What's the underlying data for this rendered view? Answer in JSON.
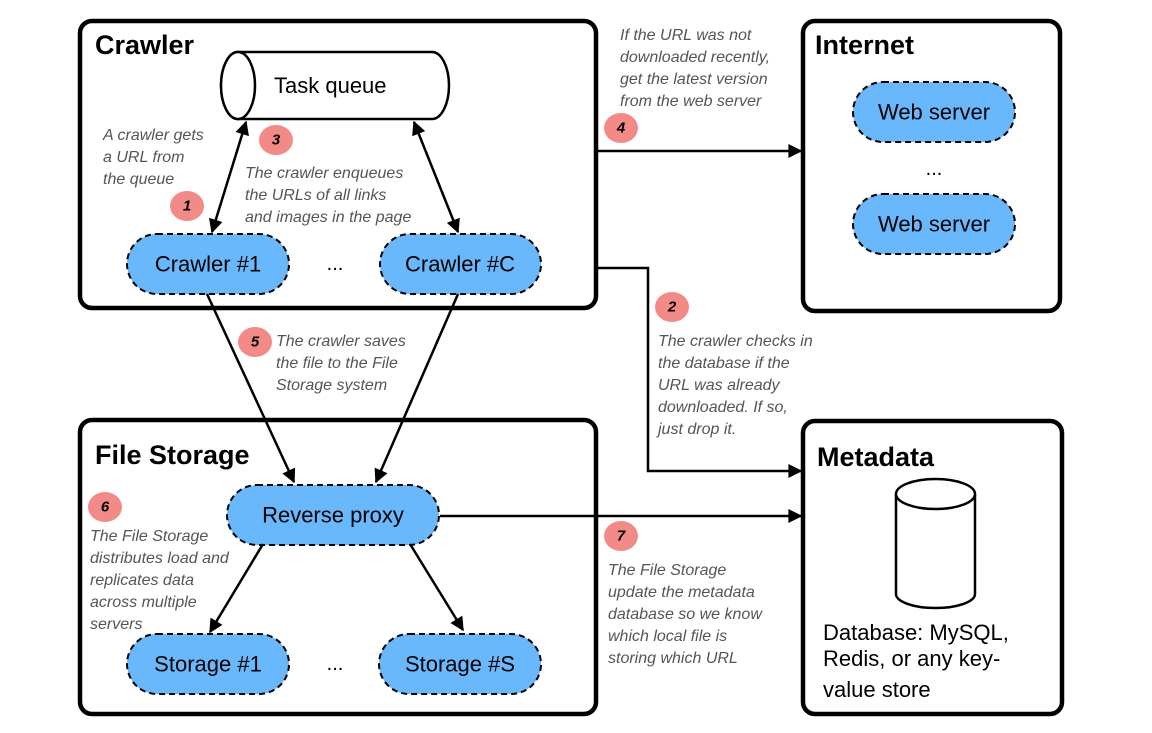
{
  "groups": {
    "crawler": {
      "title": "Crawler"
    },
    "internet": {
      "title": "Internet"
    },
    "file_storage": {
      "title": "File Storage"
    },
    "metadata": {
      "title": "Metadata"
    }
  },
  "nodes": {
    "task_queue": "Task queue",
    "crawler_1": "Crawler #1",
    "crawler_c": "Crawler #C",
    "crawler_ellipsis": "...",
    "web_server_1": "Web server",
    "web_server_2": "Web server",
    "web_ellipsis": "...",
    "reverse_proxy": "Reverse proxy",
    "storage_1": "Storage #1",
    "storage_s": "Storage #S",
    "storage_ellipsis": "...",
    "database_lines": [
      "Database: MySQL,",
      "Redis, or any key-",
      "value store"
    ]
  },
  "steps": [
    {
      "number": "1",
      "lines": [
        "A crawler gets",
        "a URL from",
        "the queue"
      ]
    },
    {
      "number": "2",
      "lines": [
        "The crawler checks in",
        "the database if the",
        "URL was already",
        "downloaded. If so,",
        "just drop it."
      ]
    },
    {
      "number": "3",
      "lines": [
        "The crawler enqueues",
        "the URLs of all links",
        "and images in the page"
      ]
    },
    {
      "number": "4",
      "lines": [
        "If the URL was not",
        "downloaded recently,",
        "get the latest version",
        "from the web server"
      ]
    },
    {
      "number": "5",
      "lines": [
        "The crawler saves",
        "the file to the File",
        "Storage system"
      ]
    },
    {
      "number": "6",
      "lines": [
        "The File Storage",
        "distributes load and",
        "replicates data",
        "across multiple",
        "servers"
      ]
    },
    {
      "number": "7",
      "lines": [
        "The File Storage",
        "update the metadata",
        "database so we know",
        "which local file is",
        "storing which URL"
      ]
    }
  ],
  "colors": {
    "node_fill": "#6ab8fc",
    "badge_fill": "#f28b87",
    "note_text": "#555555",
    "stroke": "#000000"
  }
}
